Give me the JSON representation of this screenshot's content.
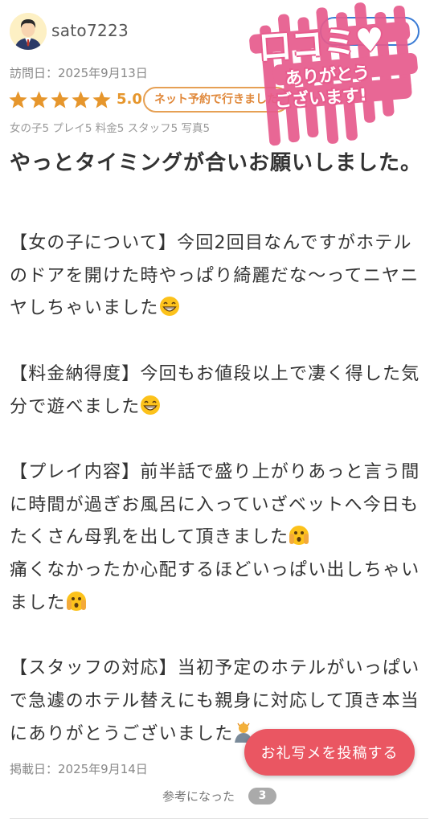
{
  "reviewer": {
    "username": "sato7223",
    "avatar_icon": "user-avatar-icon"
  },
  "visit_date": "訪問日：2025年9月13日",
  "rating": {
    "stars": 5,
    "max_stars": 5,
    "score": "5.0",
    "star_color": "#e6962c"
  },
  "badge": {
    "label": "ネット予約で行きました"
  },
  "sub_scores": "女の子5 プレイ5 料金5 スタッフ5 写真5",
  "review": {
    "title": "やっとタイミングが合いお願いしました。",
    "paragraphs": [
      {
        "text": "【女の子について】今回2回目なんですがホテルのドアを開けた時やっぱり綺麗だな〜ってニヤニヤしちゃいました",
        "emoji": "grinning-face"
      },
      {
        "text": "【料金納得度】今回もお値段以上で凄く得した気分で遊べました",
        "emoji": "grinning-face"
      },
      {
        "text": "【プレイ内容】前半話で盛り上がりあっと言う間に時間が過ぎお風呂に入っていざベットへ今日もたくさん母乳を出して頂きました",
        "emoji": "peeking-face"
      },
      {
        "text": "痛くなかったか心配するほどいっぱい出しちゃいました",
        "emoji": "peeking-face"
      },
      {
        "text": "【スタッフの対応】当初予定のホテルがいっぱいで急遽のホテル替えにも親身に対応して頂き本当にありがとうございました",
        "emoji": "bowing-person"
      }
    ]
  },
  "post_date": "掲載日：2025年9月14日",
  "photo_button": {
    "label": "お礼写メを投稿する",
    "color": "#ea5662"
  },
  "helpful": {
    "label": "参考になった",
    "count": "3"
  },
  "stamp": {
    "line1": "口コミ",
    "line2": "ありがとう",
    "line3": "ございます!",
    "color": "#e75b8d"
  }
}
